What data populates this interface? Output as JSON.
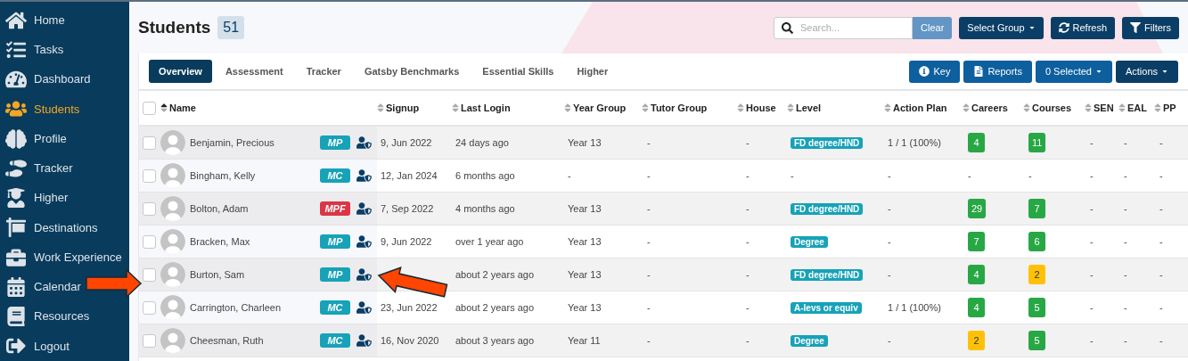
{
  "sidebar": {
    "items": [
      {
        "label": "Home",
        "selected": false
      },
      {
        "label": "Tasks",
        "selected": false
      },
      {
        "label": "Dashboard",
        "selected": false
      },
      {
        "label": "Students",
        "selected": true
      },
      {
        "label": "Profile",
        "selected": false
      },
      {
        "label": "Tracker",
        "selected": false
      },
      {
        "label": "Higher",
        "selected": false
      },
      {
        "label": "Destinations",
        "selected": false
      },
      {
        "label": "Work Experience",
        "selected": false
      },
      {
        "label": "Calendar",
        "selected": false
      },
      {
        "label": "Resources",
        "selected": false
      },
      {
        "label": "Logout",
        "selected": false
      }
    ]
  },
  "header": {
    "title": "Students",
    "count": "51",
    "search": {
      "placeholder": "Search..."
    },
    "buttons": [
      {
        "label": "Clear",
        "kind": "clear"
      },
      {
        "label": "Select Group",
        "kind": "dropdown"
      },
      {
        "label": "Refresh",
        "kind": "refresh"
      },
      {
        "label": "Filters",
        "kind": "filter"
      }
    ]
  },
  "tabs": [
    {
      "label": "Overview",
      "selected": true
    },
    {
      "label": "Assessment",
      "selected": false
    },
    {
      "label": "Tracker",
      "selected": false
    },
    {
      "label": "Gatsby Benchmarks",
      "selected": false
    },
    {
      "label": "Essential Skills",
      "selected": false
    },
    {
      "label": "Higher",
      "selected": false
    }
  ],
  "toolbar": [
    {
      "label": "Key",
      "kind": "info"
    },
    {
      "label": "Reports",
      "kind": "report"
    },
    {
      "label": "0 Selected",
      "kind": "dropdown"
    },
    {
      "label": "Actions",
      "kind": "dark-dropdown"
    }
  ],
  "table": {
    "select_all": {
      "checked": false
    },
    "columns": [
      {
        "label": "Name",
        "sorted": true
      },
      {
        "label": "Signup",
        "sorted": false
      },
      {
        "label": "Last Login",
        "sorted": false
      },
      {
        "label": "Year Group",
        "sorted": false
      },
      {
        "label": "Tutor Group",
        "sorted": false
      },
      {
        "label": "House",
        "sorted": false
      },
      {
        "label": "Level",
        "sorted": false
      },
      {
        "label": "Action Plan",
        "sorted": false
      },
      {
        "label": "Careers",
        "sorted": false
      },
      {
        "label": "Courses",
        "sorted": false
      },
      {
        "label": "SEN",
        "sorted": false
      },
      {
        "label": "EAL",
        "sorted": false
      },
      {
        "label": "PP",
        "sorted": false
      }
    ],
    "rows": [
      {
        "checked": false,
        "name": "Benjamin, Precious",
        "badge": {
          "text": "MP",
          "color": "#17a2b8"
        },
        "signup": "9, Jun 2022",
        "last_login": "24 days ago",
        "year_group": "Year 13",
        "tutor_group": "-",
        "house": "-",
        "level": {
          "text": "FD degree/HND",
          "kind": "tag"
        },
        "action_plan": "1 / 1 (100%)",
        "careers": {
          "text": "4",
          "color": "#28a745"
        },
        "courses": {
          "text": "11",
          "color": "#28a745"
        },
        "sen": "-",
        "eal": "-",
        "pp": "-"
      },
      {
        "checked": false,
        "name": "Bingham, Kelly",
        "badge": {
          "text": "MC",
          "color": "#17a2b8"
        },
        "signup": "12, Jan 2024",
        "last_login": "6 months ago",
        "year_group": "-",
        "tutor_group": "-",
        "house": "-",
        "level": {
          "text": "-",
          "kind": "plain"
        },
        "action_plan": "-",
        "careers": {
          "text": "-"
        },
        "courses": {
          "text": "-"
        },
        "sen": "-",
        "eal": "-",
        "pp": "-"
      },
      {
        "checked": false,
        "name": "Bolton, Adam",
        "badge": {
          "text": "MPF",
          "color": "#dc3545"
        },
        "signup": "7, Sep 2022",
        "last_login": "4 months ago",
        "year_group": "Year 13",
        "tutor_group": "-",
        "house": "-",
        "level": {
          "text": "FD degree/HND",
          "kind": "tag"
        },
        "action_plan": "-",
        "careers": {
          "text": "29",
          "color": "#28a745"
        },
        "courses": {
          "text": "7",
          "color": "#28a745"
        },
        "sen": "-",
        "eal": "-",
        "pp": "-"
      },
      {
        "checked": false,
        "name": "Bracken, Max",
        "badge": {
          "text": "MP",
          "color": "#17a2b8"
        },
        "signup": "9, Jun 2022",
        "last_login": "over 1 year ago",
        "year_group": "Year 13",
        "tutor_group": "-",
        "house": "-",
        "level": {
          "text": "Degree",
          "kind": "tag"
        },
        "action_plan": "-",
        "careers": {
          "text": "7",
          "color": "#28a745"
        },
        "courses": {
          "text": "6",
          "color": "#28a745"
        },
        "sen": "-",
        "eal": "-",
        "pp": "-"
      },
      {
        "checked": false,
        "name": "Burton, Sam",
        "badge": {
          "text": "MP",
          "color": "#17a2b8"
        },
        "last_login": "about 2 years ago",
        "year_group": "Year 13",
        "tutor_group": "-",
        "house": "-",
        "level": {
          "text": "FD degree/HND",
          "kind": "tag"
        },
        "action_plan": "-",
        "careers": {
          "text": "4",
          "color": "#28a745"
        },
        "courses": {
          "text": "2",
          "color": "#ffc107"
        },
        "sen": "-",
        "eal": "-",
        "pp": "-"
      },
      {
        "checked": false,
        "name": "Carrington, Charleen",
        "badge": {
          "text": "MC",
          "color": "#17a2b8"
        },
        "signup": "23, Jun 2022",
        "last_login": "about 2 years ago",
        "year_group": "Year 13",
        "tutor_group": "-",
        "house": "-",
        "level": {
          "text": "A-levs or equiv",
          "kind": "tag"
        },
        "action_plan": "1 / 1 (100%)",
        "careers": {
          "text": "4",
          "color": "#28a745"
        },
        "courses": {
          "text": "5",
          "color": "#28a745"
        },
        "sen": "-",
        "eal": "-",
        "pp": "-"
      },
      {
        "checked": false,
        "name": "Cheesman, Ruth",
        "badge": {
          "text": "MC",
          "color": "#17a2b8"
        },
        "signup": "16, Nov 2020",
        "last_login": "about 3 years ago",
        "year_group": "Year 11",
        "tutor_group": "-",
        "house": "-",
        "level": {
          "text": "Degree",
          "kind": "tag"
        },
        "action_plan": "-",
        "careers": {
          "text": "2",
          "color": "#ffc107"
        },
        "courses": {
          "text": "5",
          "color": "#28a745"
        },
        "sen": "-",
        "eal": "-",
        "pp": "-"
      }
    ]
  }
}
